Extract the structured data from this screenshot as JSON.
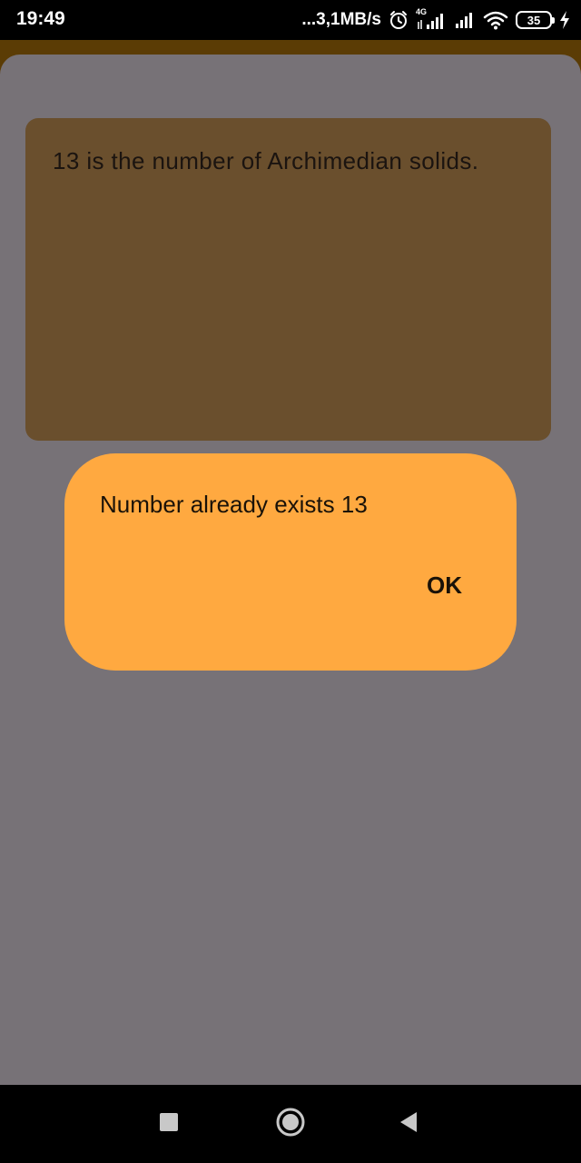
{
  "status_bar": {
    "time": "19:49",
    "net_speed": "...3,1MB/s",
    "network_type": "4G",
    "battery_level": "35",
    "icons": [
      "alarm-icon",
      "signal-4g-icon",
      "signal-icon",
      "wifi-icon",
      "battery-icon",
      "charging-icon"
    ]
  },
  "fact_card": {
    "text": "13 is the number of Archimedian solids."
  },
  "dialog": {
    "message": "Number already exists 13",
    "ok_label": "OK"
  },
  "nav_bar": {
    "icons": [
      "recent-apps-icon",
      "home-icon",
      "back-icon"
    ]
  },
  "colors": {
    "app_background": "#5b3c05",
    "scrim": "#777277",
    "card": "#6a4f2d",
    "dialog": "#ffa940"
  }
}
